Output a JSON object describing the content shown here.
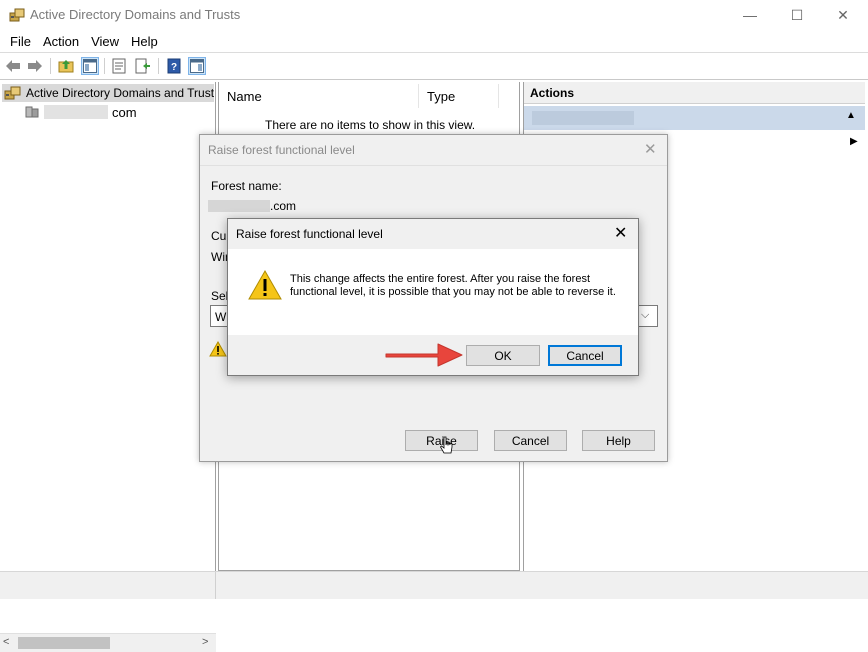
{
  "window": {
    "title": "Active Directory Domains and Trusts",
    "controls": {
      "minimize": "—",
      "maximize": "☐",
      "close": "✕"
    }
  },
  "menu": [
    "File",
    "Action",
    "View",
    "Help"
  ],
  "tree": {
    "root_label": "Active Directory Domains and Trusts",
    "child_label": "com"
  },
  "list": {
    "columns": [
      "Name",
      "Type"
    ],
    "empty_message": "There are no items to show in this view."
  },
  "actions": {
    "header": "Actions"
  },
  "dialog_outer": {
    "title": "Raise forest functional level",
    "forest_name_label": "Forest name:",
    "forest_name_value": ".com",
    "partial_labels": [
      "Cur",
      "Win",
      "Sele",
      "Wi"
    ],
    "buttons": {
      "raise": "Raise",
      "cancel": "Cancel",
      "help": "Help"
    }
  },
  "dialog_confirm": {
    "title": "Raise forest functional level",
    "message": "This change affects the entire forest. After you raise the forest functional level, it is possible that you may not be able to reverse it.",
    "buttons": {
      "ok": "OK",
      "cancel": "Cancel"
    }
  },
  "colors": {
    "selection": "#cbd9ea",
    "focus_border": "#0078d7",
    "annotation_arrow": "#e8453c",
    "warning_yellow": "#f5c518"
  }
}
